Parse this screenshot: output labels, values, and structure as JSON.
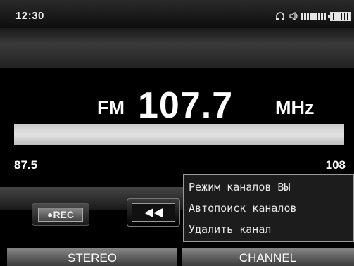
{
  "status_bar": {
    "time": "12:30",
    "icons": [
      "headphones-icon",
      "volume-icon",
      "battery-icon"
    ]
  },
  "radio": {
    "band": "FM",
    "frequency": "107.7",
    "unit": "MHz",
    "range_min": "87.5",
    "range_max": "108",
    "tuning_level": 0.99
  },
  "controls": {
    "rec_label": "●REC",
    "rewind_label": "◀◀"
  },
  "menu": {
    "items": [
      "Режим каналов ВЫ",
      "Автопоиск каналов",
      "Удалить канал"
    ]
  },
  "softkeys": {
    "left": "STEREO",
    "right": "CHANNEL"
  }
}
